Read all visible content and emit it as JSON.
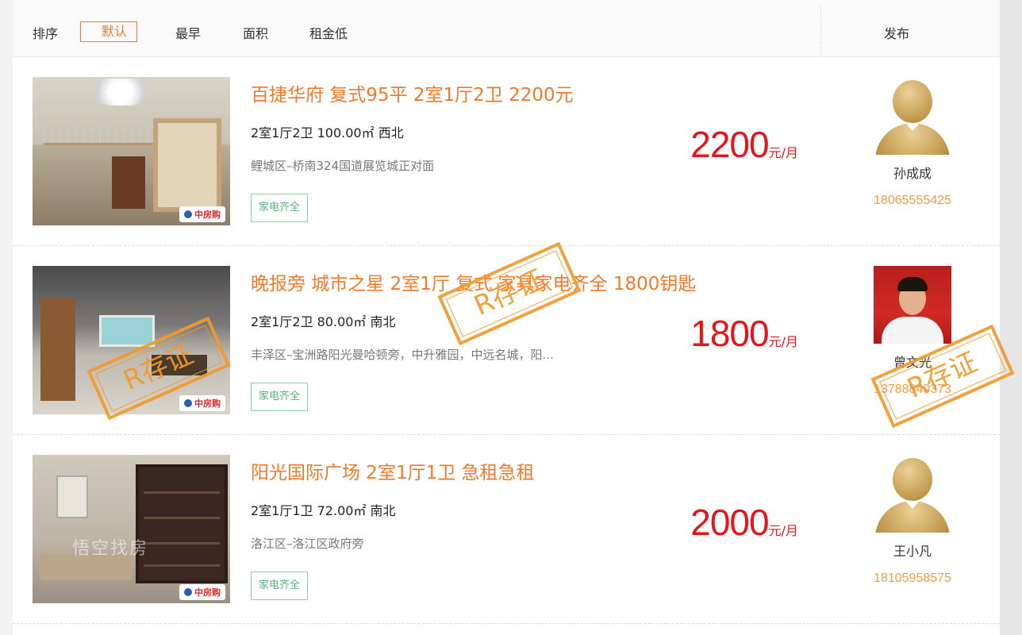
{
  "sortbar": {
    "label": "排序",
    "options": [
      "默认",
      "最早",
      "面积",
      "租金低"
    ],
    "active_index": 0,
    "publish_header": "发布"
  },
  "listings": [
    {
      "title": "百捷华府 复式95平 2室1厅2卫 2200元",
      "specs": "2室1厅2卫 100.00㎡ 西北",
      "address": "鲤城区–桥南324国道展览城正对面",
      "tag": "家电齐全",
      "price": "2200",
      "price_unit": "元/月",
      "photo_brand": "中房购",
      "agent": {
        "name": "孙成成",
        "phone": "18065555425",
        "avatar": "default-avatar-icon"
      }
    },
    {
      "title": "晚报旁 城市之星 2室1厅 复式 家具家电齐全 1800钥匙",
      "specs": "2室1厅2卫 80.00㎡ 南北",
      "address": "丰泽区–宝洲路阳光曼哈顿旁，中升雅园，中远名城，阳...",
      "tag": "家电齐全",
      "price": "1800",
      "price_unit": "元/月",
      "photo_brand": "中房购",
      "agent": {
        "name": "曾文光",
        "phone": "13788840373",
        "avatar": "photo"
      }
    },
    {
      "title": "阳光国际广场 2室1厅1卫 急租急租",
      "specs": "2室1厅1卫 72.00㎡ 南北",
      "address": "洛江区–洛江区政府旁",
      "tag": "家电齐全",
      "price": "2000",
      "price_unit": "元/月",
      "photo_brand": "中房购",
      "photo_watermark": "悟空找房",
      "agent": {
        "name": "王小凡",
        "phone": "18105958575",
        "avatar": "default-avatar-icon"
      }
    }
  ],
  "overlay": {
    "stamp_text": "R存证"
  },
  "colors": {
    "accent": "#f07a2a",
    "price": "#e5161b",
    "phone": "#f49a46",
    "tag_border": "#8ed0a3",
    "stamp": "#f39a2c"
  }
}
